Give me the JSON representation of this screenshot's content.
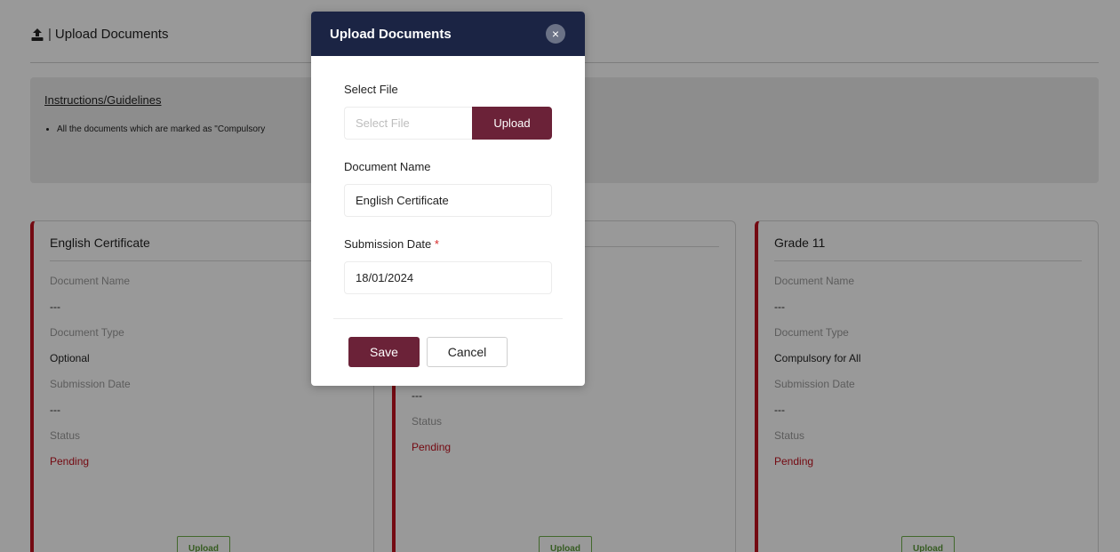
{
  "header": {
    "separator": "|",
    "title": "Upload Documents"
  },
  "instructions": {
    "title": "Instructions/Guidelines",
    "items": [
      "All the documents which are marked as \"Compulsory"
    ]
  },
  "field_labels": {
    "document_name": "Document Name",
    "document_type": "Document Type",
    "submission_date": "Submission Date",
    "status": "Status"
  },
  "cards": [
    {
      "title": "English Certificate",
      "document_name": "---",
      "document_type": "Optional",
      "submission_date": "---",
      "status": "Pending",
      "upload_label": "Upload"
    },
    {
      "title": "",
      "document_name": "",
      "document_type": "",
      "submission_date": "---",
      "status": "Pending",
      "upload_label": "Upload"
    },
    {
      "title": "Grade 11",
      "document_name": "---",
      "document_type": "Compulsory for All",
      "submission_date": "---",
      "status": "Pending",
      "upload_label": "Upload"
    }
  ],
  "modal": {
    "title": "Upload Documents",
    "close_glyph": "×",
    "select_file_label": "Select File",
    "select_file_placeholder": "Select File",
    "upload_button": "Upload",
    "document_name_label": "Document Name",
    "document_name_value": "English Certificate",
    "submission_date_label": "Submission Date",
    "required_mark": "*",
    "submission_date_value": "18/01/2024",
    "save_label": "Save",
    "cancel_label": "Cancel"
  },
  "colors": {
    "modal_header": "#1b2444",
    "primary_button": "#6b2238",
    "card_accent": "#c1121f",
    "pending_status": "#c1121f",
    "card_upload_border": "#6fae4a"
  },
  "icons": {
    "header_icon": "upload-icon",
    "modal_close": "close-icon"
  }
}
